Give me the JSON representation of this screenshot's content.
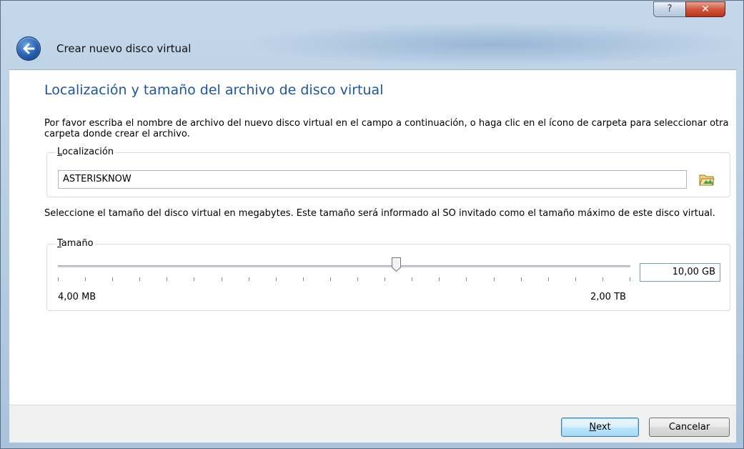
{
  "window": {
    "title": "Crear nuevo disco virtual",
    "help_glyph": "?",
    "close_glyph": "✕"
  },
  "heading": "Localización y tamaño del archivo de disco virtual",
  "location_description": "Por favor escriba el nombre de archivo del nuevo disco virtual en el campo a continuación, o haga clic en el ícono de carpeta para seleccionar otra carpeta donde crear el archivo.",
  "location_group": {
    "legend_accel": "L",
    "legend_rest": "ocalización",
    "path_value": "ASTERISKNOW"
  },
  "size_description": "Seleccione el tamaño del disco virtual en megabytes. Este tamaño será informado al SO invitado como el tamaño máximo de este disco virtual.",
  "size_group": {
    "legend_accel": "T",
    "legend_rest": "amaño",
    "min_label": "4,00 MB",
    "max_label": "2,00 TB",
    "size_value": "10,00 GB",
    "slider_fraction": 0.59
  },
  "buttons": {
    "next_accel": "N",
    "next_rest": "ext",
    "cancel": "Cancelar"
  },
  "colors": {
    "heading": "#1d55a4",
    "accent": "#3c7fb1"
  }
}
